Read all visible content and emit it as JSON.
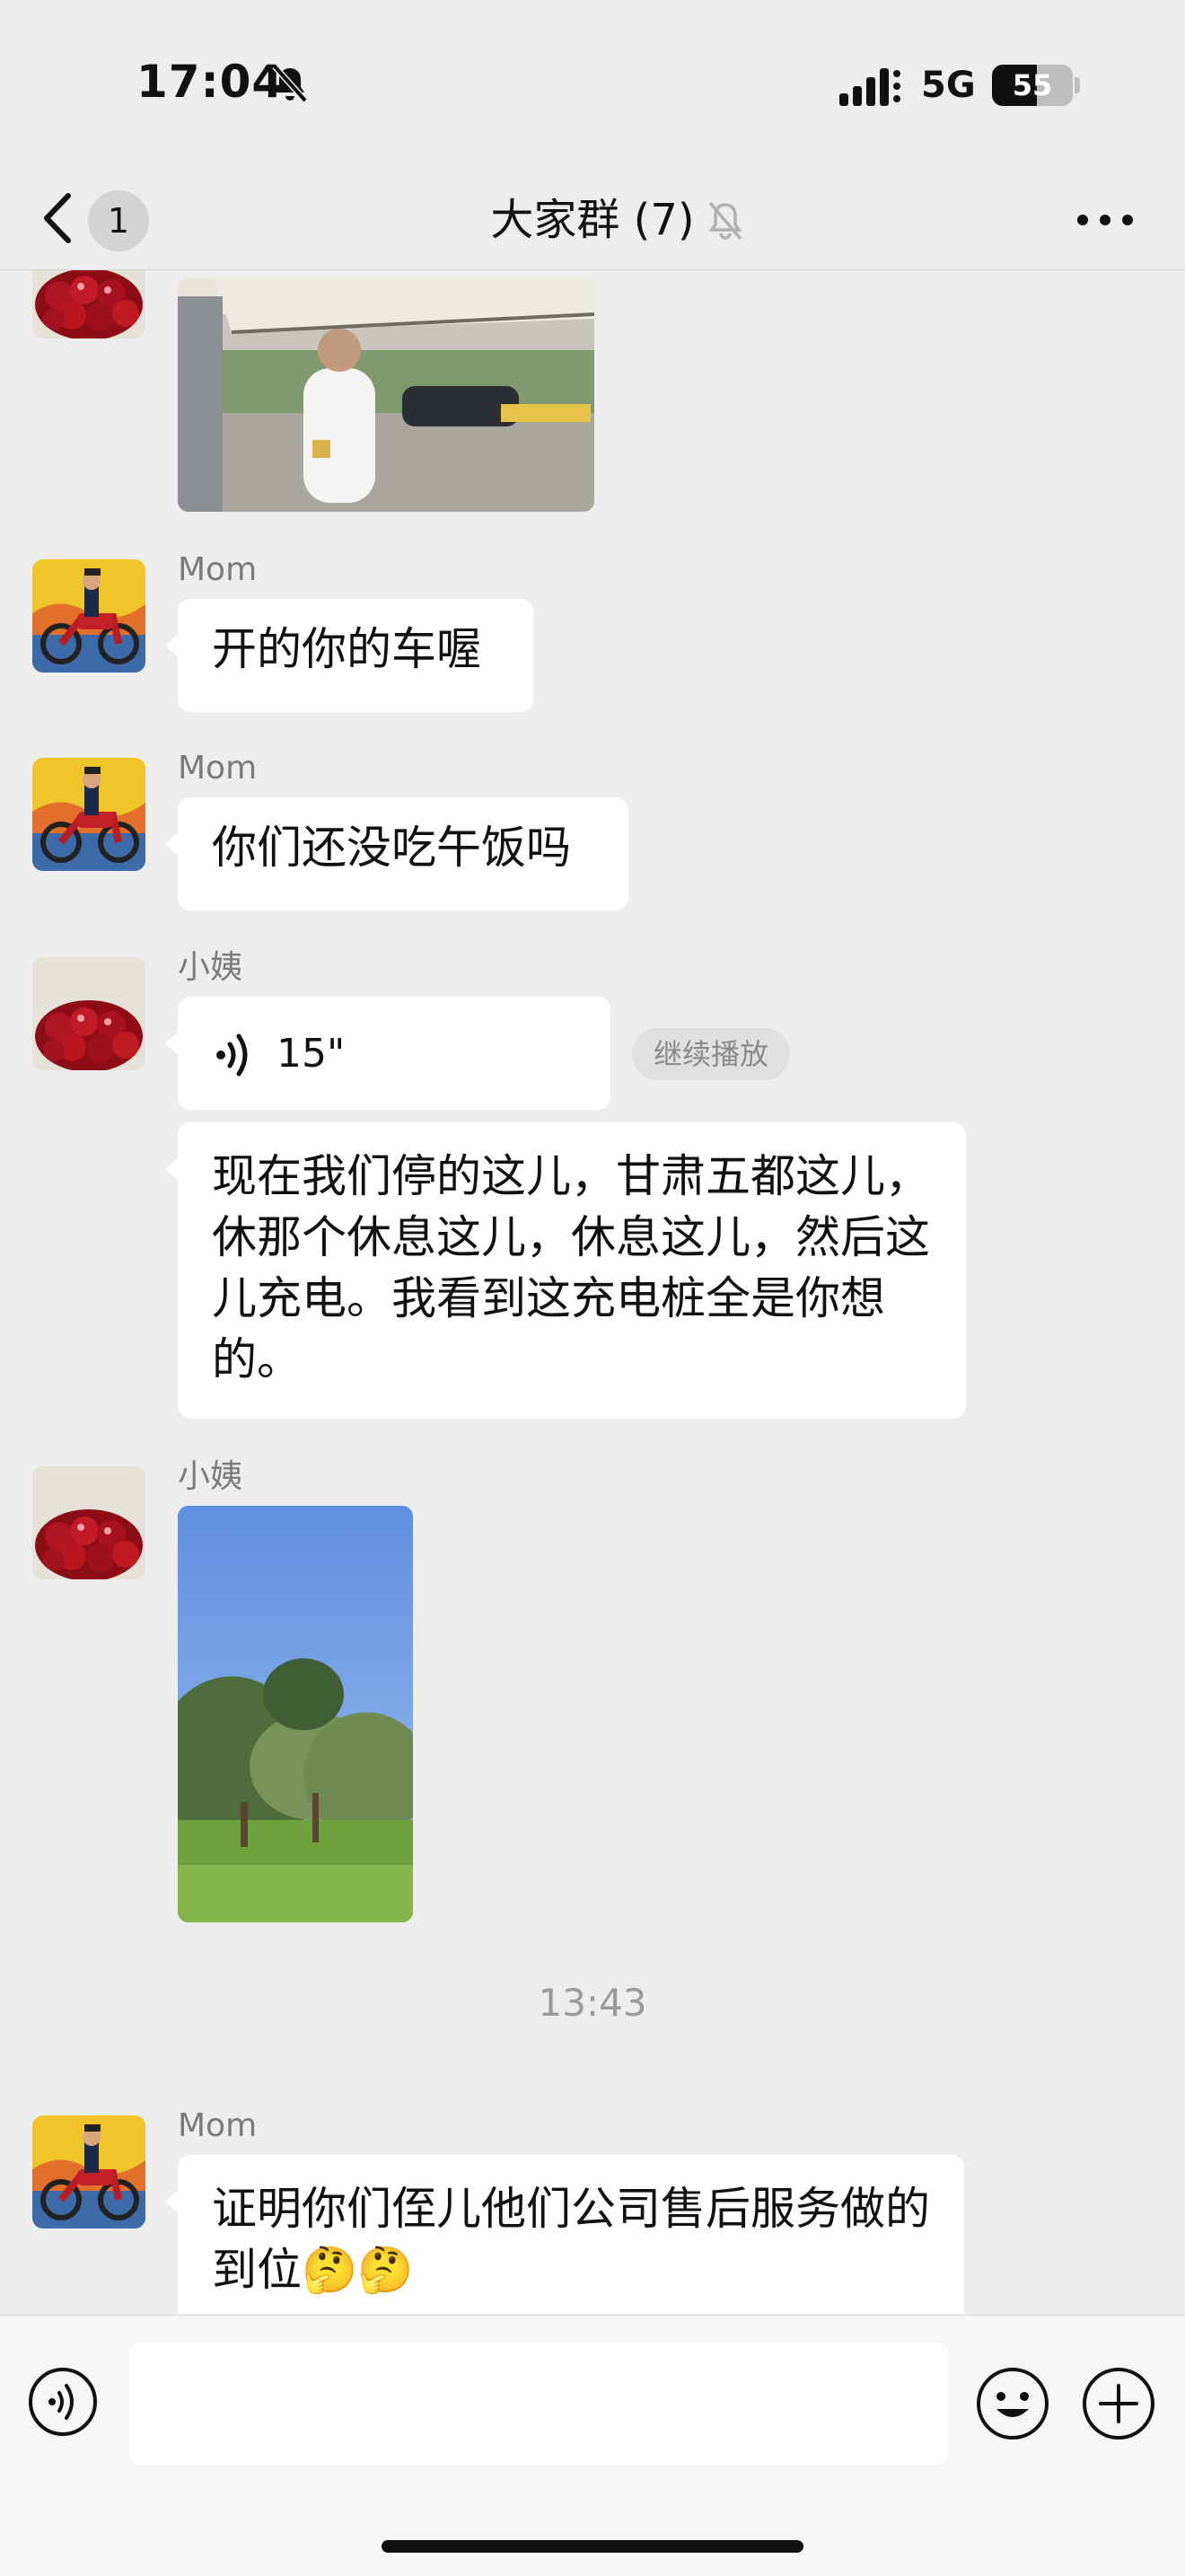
{
  "status_bar": {
    "time": "17:04",
    "network": "5G",
    "battery": "55",
    "battery_level": 0.55
  },
  "nav": {
    "unread_count": "1",
    "title": "大家群 (7)"
  },
  "messages": [
    {
      "sender": "Mom",
      "text": "开的你的车喔"
    },
    {
      "sender": "Mom",
      "text": "你们还没吃午饭吗"
    },
    {
      "sender": "小姨",
      "voice_length": "15\"",
      "resume_label": "继续播放",
      "transcript": "现在我们停的这儿，甘肃五都这儿，休那个休息这儿，休息这儿，然后这儿充电。我看到这充电桩全是你想的。"
    },
    {
      "sender": "小姨"
    },
    {
      "sender": "Mom",
      "text": "证明你们侄儿他们公司售后服务做的到位🤔🤔"
    }
  ],
  "timestamp": "13:43",
  "input": {
    "value": "",
    "placeholder": ""
  }
}
